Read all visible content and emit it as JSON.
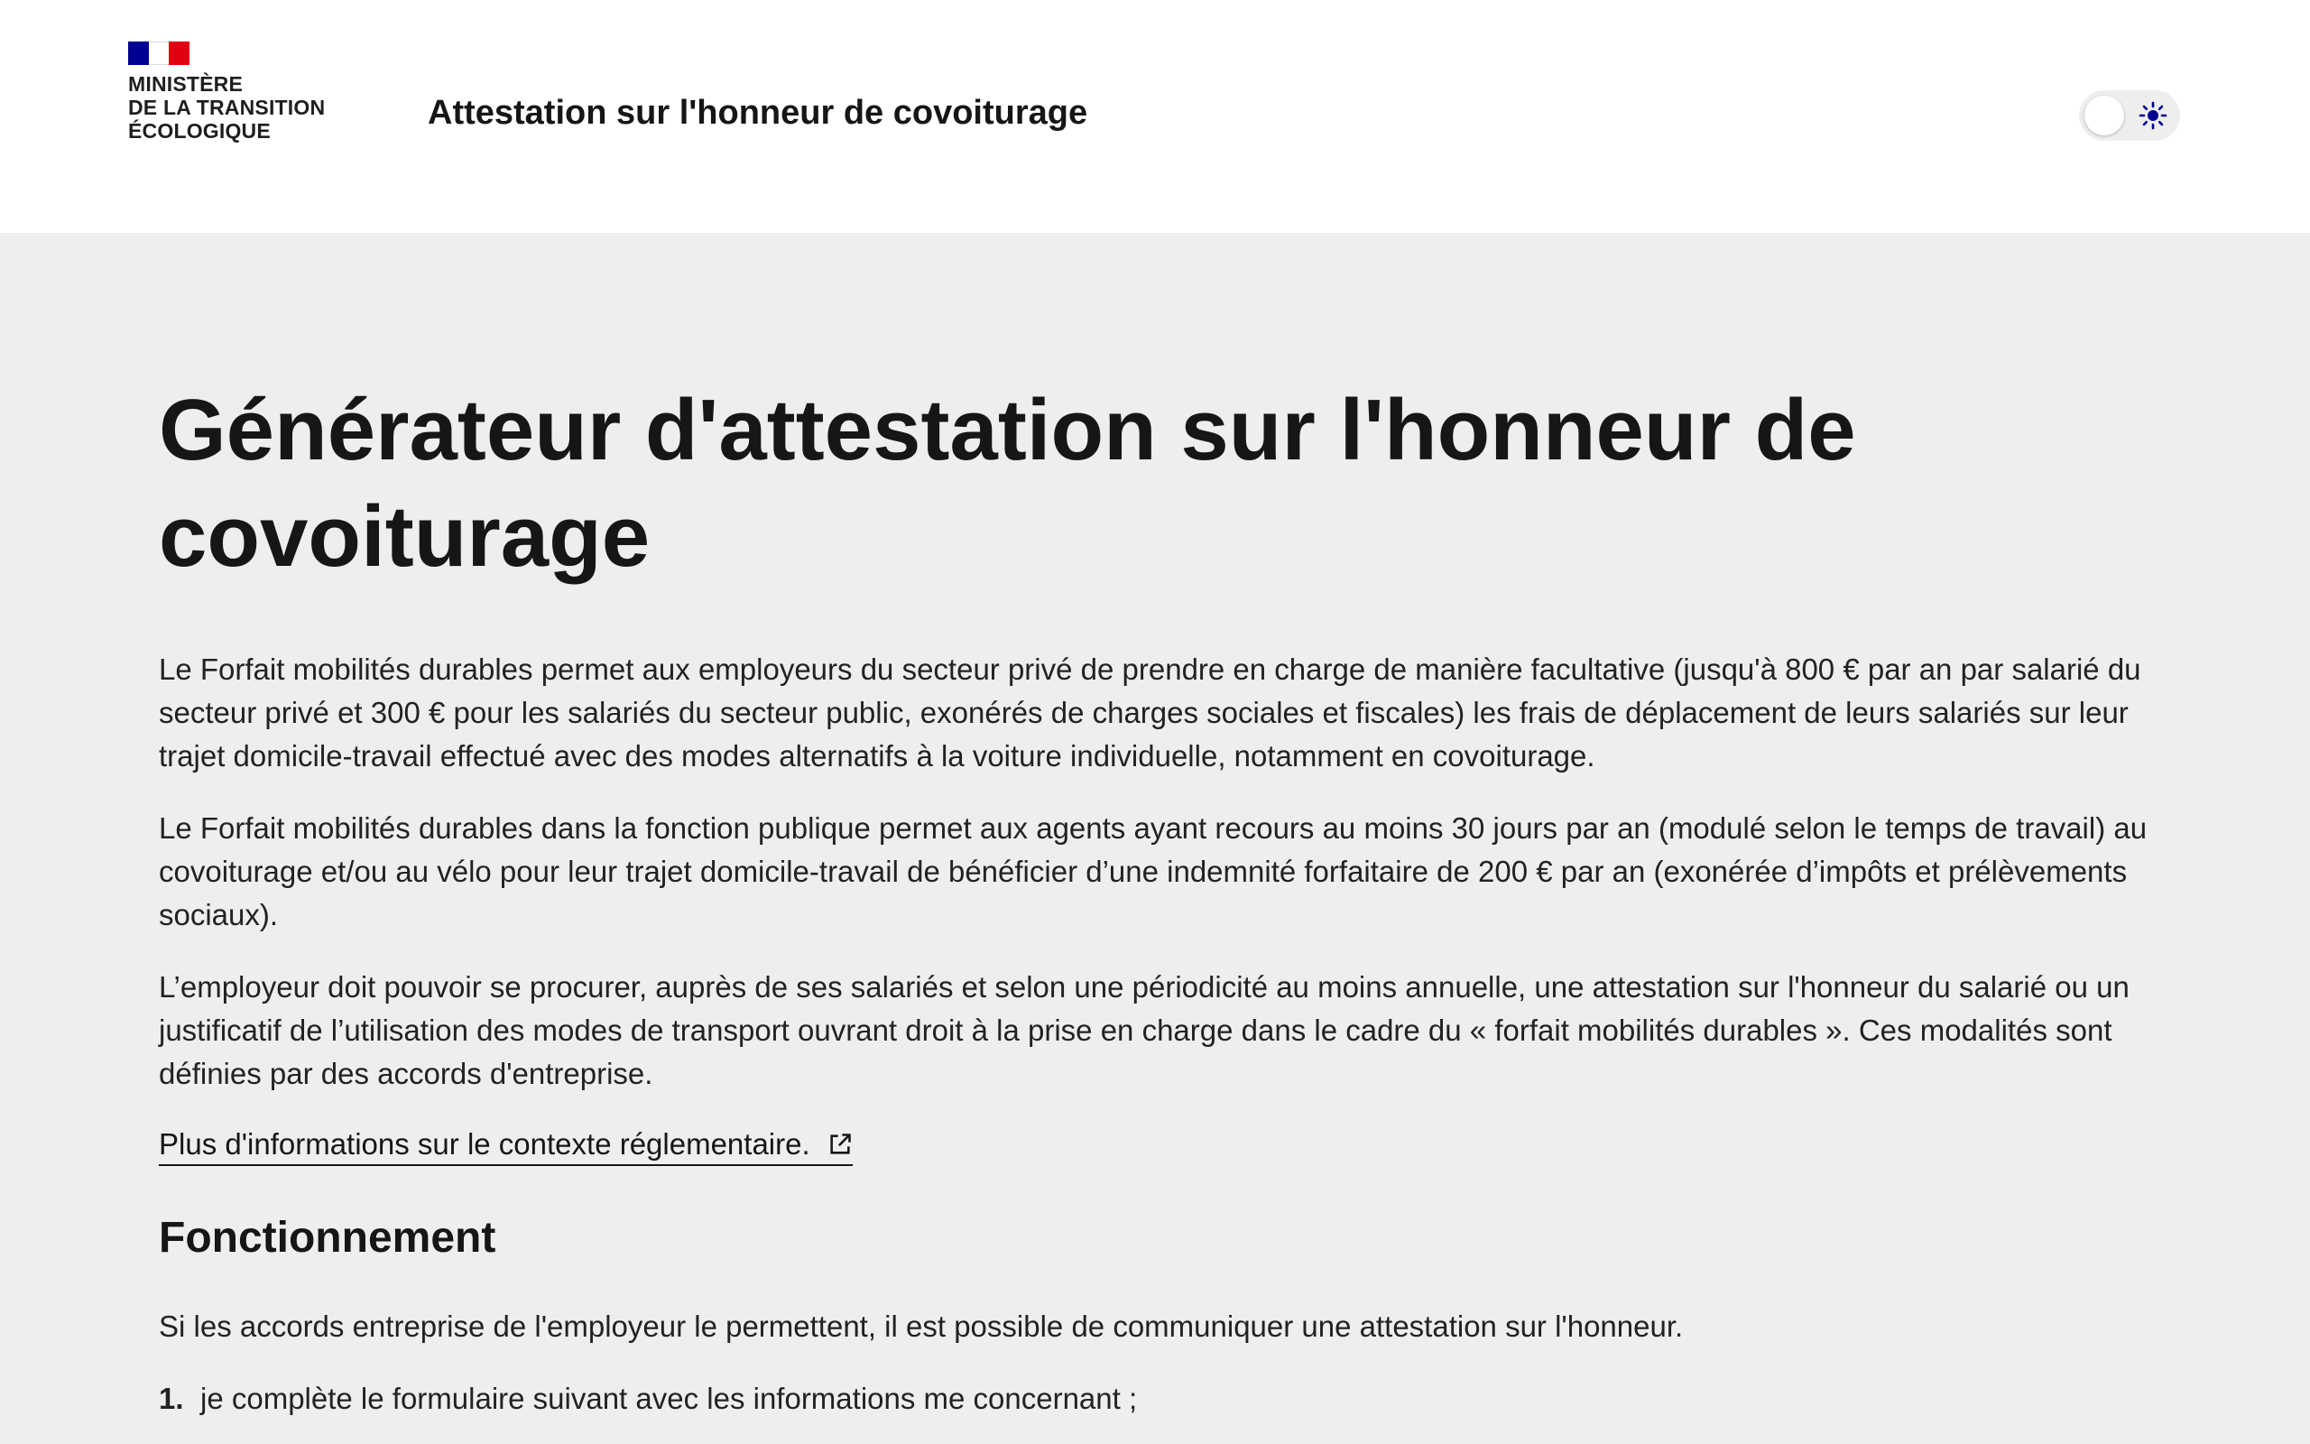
{
  "header": {
    "ministry_lines": [
      "Ministère",
      "de la transition",
      "écologique"
    ],
    "service_title": "Attestation sur l'honneur de covoiturage",
    "theme_toggle_icon": "sun-icon"
  },
  "colors": {
    "flag_blue": "#000091",
    "flag_red": "#e1000f",
    "page_bg": "#eeeeee",
    "header_bg": "#ffffff",
    "toggle_sun": "#000091"
  },
  "main": {
    "title": "Générateur d'attestation sur l'honneur de covoiturage",
    "paragraphs": [
      "Le Forfait mobilités durables permet aux employeurs du secteur privé de prendre en charge de manière facultative (jusqu'à 800 € par an par salarié du secteur privé et 300 € pour les salariés du secteur public, exonérés de charges sociales et fiscales) les frais de déplacement de leurs salariés sur leur trajet domicile-travail effectué avec des modes alternatifs à la voiture individuelle, notamment en covoiturage.",
      "Le Forfait mobilités durables dans la fonction publique permet aux agents ayant recours au moins 30 jours par an (modulé selon le temps de travail) au covoiturage et/ou au vélo pour leur trajet domicile-travail de bénéficier d’une indemnité forfaitaire de 200 € par an (exonérée d’impôts et prélèvements sociaux).",
      "L’employeur doit pouvoir se procurer, auprès de ses salariés et selon une périodicité au moins annuelle, une attestation sur l'honneur du salarié ou un justificatif de l’utilisation des modes de transport ouvrant droit à la prise en charge dans le cadre du « forfait mobilités durables ». Ces modalités sont définies par des accords d'entreprise."
    ],
    "info_link": "Plus d'informations sur le contexte réglementaire.",
    "info_link_icon": "external-link-icon",
    "section_title": "Fonctionnement",
    "section_intro": "Si les accords entreprise de l'employeur le permettent, il est possible de communiquer une attestation sur l'honneur.",
    "steps": [
      {
        "number": "1.",
        "text": "je complète le formulaire suivant avec les informations me concernant ;"
      }
    ]
  }
}
